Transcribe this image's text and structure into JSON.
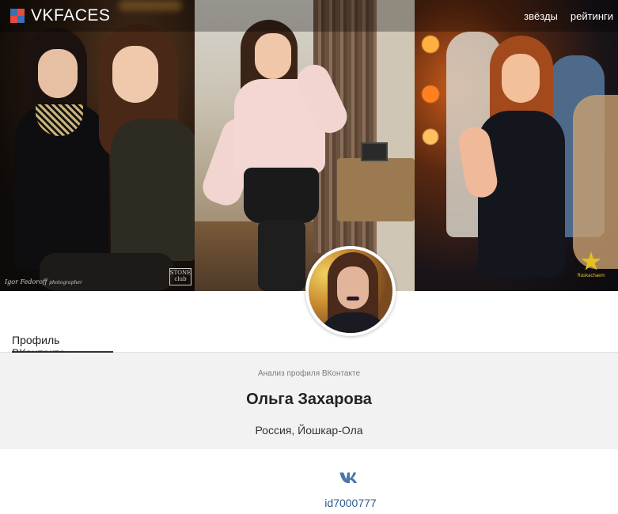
{
  "header": {
    "brand": "VKFACES",
    "nav": [
      {
        "label": "звёзды"
      },
      {
        "label": "рейтинги"
      }
    ]
  },
  "hero": {
    "photo1_watermark": "Igor Fedoroff",
    "photo1_watermark_sub": "photographer",
    "photo1_logo": "STONE",
    "photo1_logo_sub": "club",
    "photo3_logo": "Raskachaem"
  },
  "tabs": [
    {
      "label": "Профиль ВКонтакте",
      "active": true
    }
  ],
  "profile": {
    "caption": "Анализ профиля ВКонтакте",
    "name": "Ольга Захарова",
    "location": "Россия, Йошкар-Ола",
    "vk_id": "id7000777"
  },
  "icons": {
    "brand": "vkfaces-logo-icon",
    "vk": "vk-logo-icon"
  },
  "colors": {
    "link": "#2d5d8e",
    "vk_blue": "#4a76a8",
    "band": "#f2f2f2",
    "brand_red": "#e94b3c",
    "brand_blue": "#3b6fb6"
  }
}
